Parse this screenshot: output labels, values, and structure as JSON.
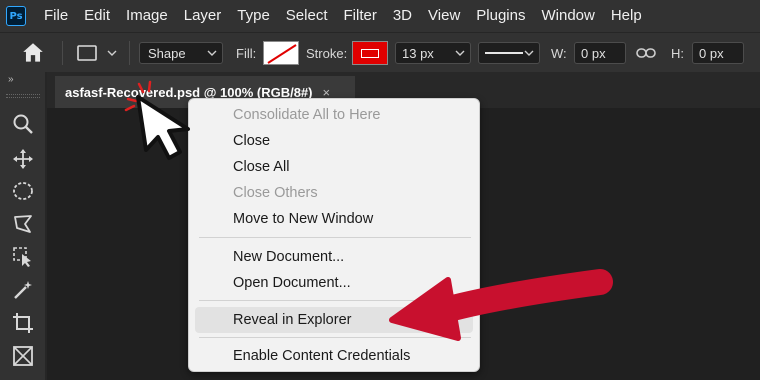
{
  "app": {
    "logo": "Ps"
  },
  "menubar": {
    "items": [
      "File",
      "Edit",
      "Image",
      "Layer",
      "Type",
      "Select",
      "Filter",
      "3D",
      "View",
      "Plugins",
      "Window",
      "Help"
    ]
  },
  "options": {
    "mode_value": "Shape",
    "fill_label": "Fill:",
    "stroke_label": "Stroke:",
    "stroke_color": "#e00000",
    "stroke_width_value": "13 px",
    "w_label": "W:",
    "w_value": "0 px",
    "h_label": "H:",
    "h_value": "0 px"
  },
  "toolbar": {
    "collapse_glyph": "»",
    "tools": [
      "zoom-icon",
      "move-icon",
      "elliptical-marquee-icon",
      "lasso-icon",
      "object-selection-icon",
      "magic-wand-icon",
      "crop-icon",
      "frame-icon"
    ]
  },
  "tab": {
    "title": "asfasf-Recovered.psd @ 100% (RGB/8#)",
    "close_glyph": "×"
  },
  "context_menu": {
    "items": [
      {
        "label": "Consolidate All to Here",
        "enabled": false
      },
      {
        "label": "Close",
        "enabled": true
      },
      {
        "label": "Close All",
        "enabled": true
      },
      {
        "label": "Close Others",
        "enabled": false
      },
      {
        "label": "Move to New Window",
        "enabled": true
      },
      {
        "label": "New Document...",
        "enabled": true
      },
      {
        "label": "Open Document...",
        "enabled": true
      },
      {
        "label": "Reveal in Explorer",
        "enabled": true,
        "highlighted": true
      },
      {
        "label": "Enable Content Credentials",
        "enabled": true
      }
    ]
  },
  "colors": {
    "accent_red": "#c8102e",
    "ps_blue": "#31a8ff"
  }
}
